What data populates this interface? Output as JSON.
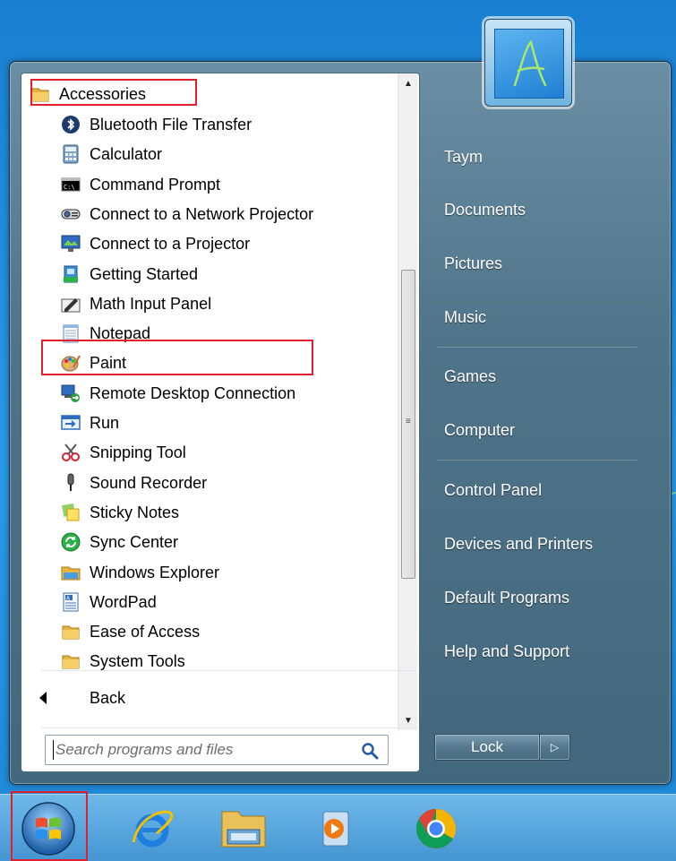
{
  "programs": {
    "header": {
      "label": "Accessories",
      "icon": "folder-icon"
    },
    "items": [
      {
        "label": "Bluetooth File Transfer",
        "icon": "bluetooth-icon"
      },
      {
        "label": "Calculator",
        "icon": "calculator-icon"
      },
      {
        "label": "Command Prompt",
        "icon": "command-prompt-icon"
      },
      {
        "label": "Connect to a Network Projector",
        "icon": "network-projector-icon"
      },
      {
        "label": "Connect to a Projector",
        "icon": "projector-icon"
      },
      {
        "label": "Getting Started",
        "icon": "getting-started-icon"
      },
      {
        "label": "Math Input Panel",
        "icon": "math-input-icon"
      },
      {
        "label": "Notepad",
        "icon": "notepad-icon"
      },
      {
        "label": "Paint",
        "icon": "paint-palette-icon"
      },
      {
        "label": "Remote Desktop Connection",
        "icon": "remote-desktop-icon"
      },
      {
        "label": "Run",
        "icon": "run-icon"
      },
      {
        "label": "Snipping Tool",
        "icon": "scissors-icon"
      },
      {
        "label": "Sound Recorder",
        "icon": "microphone-icon"
      },
      {
        "label": "Sticky Notes",
        "icon": "sticky-notes-icon"
      },
      {
        "label": "Sync Center",
        "icon": "sync-icon"
      },
      {
        "label": "Windows Explorer",
        "icon": "explorer-icon"
      },
      {
        "label": "WordPad",
        "icon": "wordpad-icon"
      },
      {
        "label": "Ease of Access",
        "icon": "folder-icon"
      },
      {
        "label": "System Tools",
        "icon": "folder-icon"
      }
    ],
    "back_label": "Back"
  },
  "search": {
    "placeholder": "Search programs and files"
  },
  "user": {
    "avatar_letter": "A"
  },
  "right_links": [
    {
      "label": "Taym"
    },
    {
      "label": "Documents"
    },
    {
      "label": "Pictures"
    },
    {
      "label": "Music"
    },
    {
      "label": "Games"
    },
    {
      "label": "Computer"
    },
    {
      "label": "Control Panel"
    },
    {
      "label": "Devices and Printers"
    },
    {
      "label": "Default Programs"
    },
    {
      "label": "Help and Support"
    }
  ],
  "shutdown": {
    "label": "Lock"
  },
  "taskbar": {
    "items": [
      {
        "icon": "windows-start-orb-icon"
      },
      {
        "icon": "internet-explorer-icon"
      },
      {
        "icon": "file-explorer-icon"
      },
      {
        "icon": "media-player-icon"
      },
      {
        "icon": "chrome-icon"
      }
    ]
  },
  "colors": {
    "highlight": "#e0202c",
    "menu_frame": "#4f7388",
    "desktop": "#1e86d6"
  }
}
